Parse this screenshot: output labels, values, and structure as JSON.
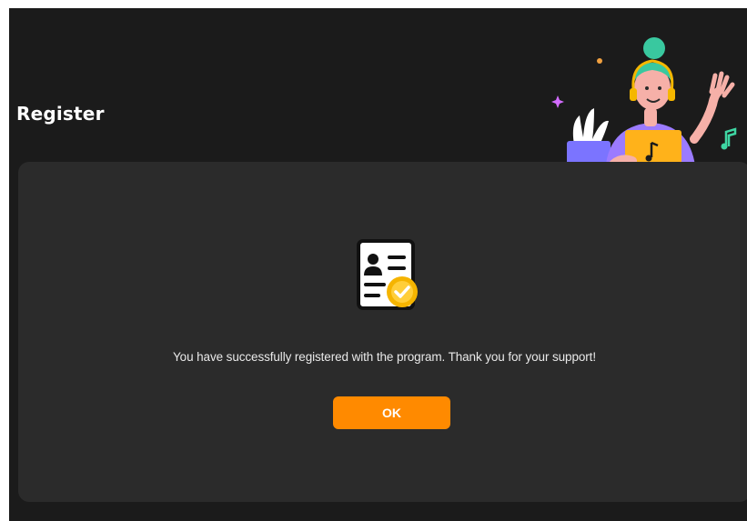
{
  "header": {
    "title": "Register"
  },
  "illustration": {
    "icon": "person-with-laptop-illustration"
  },
  "dialog": {
    "icon": "registration-document-check-icon",
    "message": "You have successfully registered with the program. Thank you for your support!",
    "ok_label": "OK"
  },
  "colors": {
    "background": "#1b1b1b",
    "panel": "#2b2b2b",
    "accent": "#ff8a00",
    "text": "#ffffff"
  }
}
